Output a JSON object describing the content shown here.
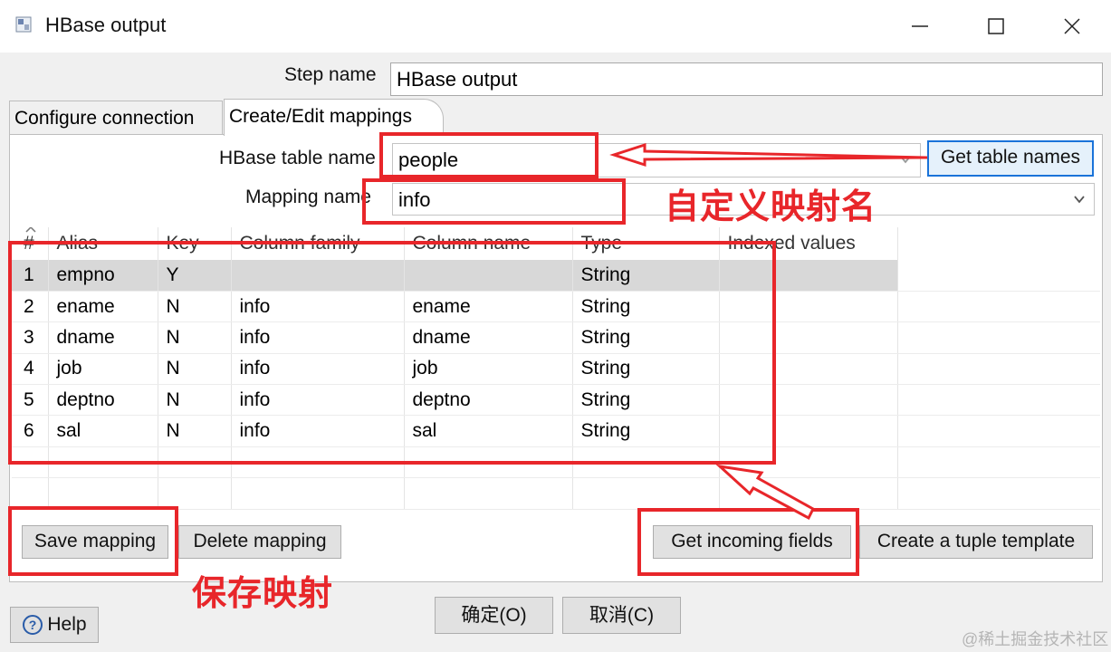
{
  "window": {
    "title": "HBase output",
    "icon_name": "hbase-icon"
  },
  "step_name": {
    "label": "Step name",
    "value": "HBase output"
  },
  "tabs": [
    {
      "label": "Configure connection",
      "active": false
    },
    {
      "label": "Create/Edit mappings",
      "active": true
    }
  ],
  "mapping_form": {
    "table_label": "HBase table name",
    "table_value": "people",
    "get_table_names_label": "Get table names",
    "mapping_label": "Mapping name",
    "mapping_value": "info"
  },
  "grid": {
    "columns": [
      "#",
      "Alias",
      "Key",
      "Column family",
      "Column name",
      "Type",
      "Indexed values"
    ],
    "rows": [
      [
        "1",
        "empno",
        "Y",
        "",
        "",
        "String",
        ""
      ],
      [
        "2",
        "ename",
        "N",
        "info",
        "ename",
        "String",
        ""
      ],
      [
        "3",
        "dname",
        "N",
        "info",
        "dname",
        "String",
        ""
      ],
      [
        "4",
        "job",
        "N",
        "info",
        "job",
        "String",
        ""
      ],
      [
        "5",
        "deptno",
        "N",
        "info",
        "deptno",
        "String",
        ""
      ],
      [
        "6",
        "sal",
        "N",
        "info",
        "sal",
        "String",
        ""
      ]
    ],
    "selected_row": 0
  },
  "buttons": {
    "save_mapping": "Save mapping",
    "delete_mapping": "Delete mapping",
    "get_incoming_fields": "Get incoming fields",
    "create_tuple_template": "Create a tuple template",
    "help": "Help",
    "ok": "确定(O)",
    "cancel": "取消(C)"
  },
  "annotations": {
    "mapping_note": "自定义映射名",
    "save_note": "保存映射",
    "color": "#e8262a"
  },
  "watermark": "@稀土掘金技术社区"
}
